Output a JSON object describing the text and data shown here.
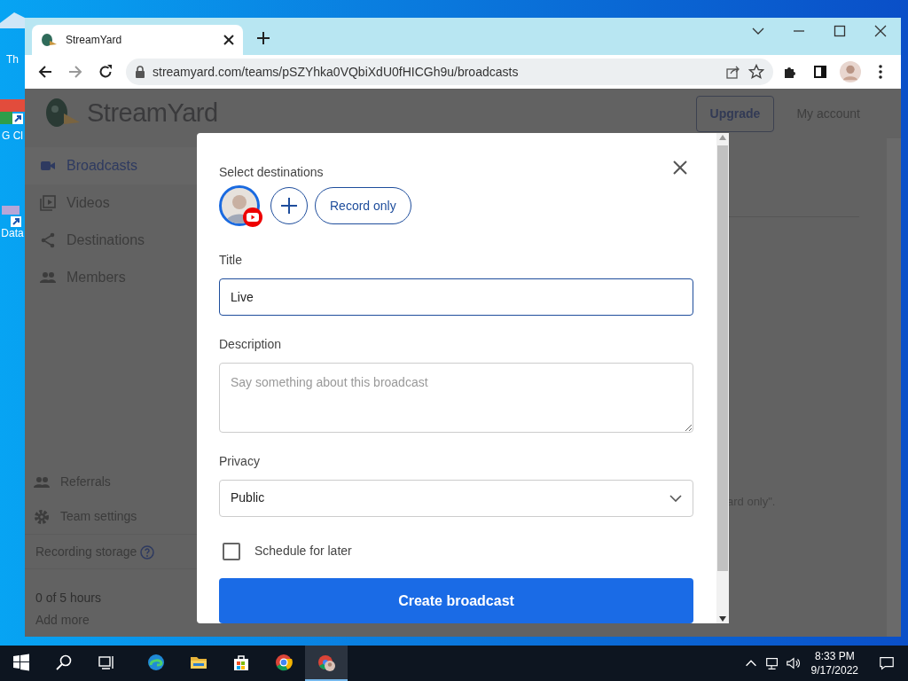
{
  "desktop": {
    "icons": [
      {
        "label": "Th"
      },
      {
        "label": "G Cl"
      },
      {
        "label": "Data"
      }
    ]
  },
  "browser": {
    "tabs": [
      {
        "title": "StreamYard",
        "selected": true
      }
    ],
    "url": "streamyard.com/teams/pSZYhka0VQbiXdU0fHICGh9u/broadcasts"
  },
  "page": {
    "logo": "StreamYard",
    "upgrade": "Upgrade",
    "account": "My account",
    "sidebar": [
      {
        "label": "Broadcasts",
        "selected": true
      },
      {
        "label": "Videos",
        "selected": false
      },
      {
        "label": "Destinations",
        "selected": false
      },
      {
        "label": "Members",
        "selected": false
      }
    ],
    "bottom_items": [
      {
        "label": "Referrals"
      },
      {
        "label": "Team settings"
      }
    ],
    "storage": {
      "label": "Recording storage",
      "usage": "0 of 5 hours",
      "link": "Add more"
    },
    "background_text": "ard only\"."
  },
  "modal": {
    "destinations_label": "Select destinations",
    "destinations": [
      {
        "kind": "avatar",
        "selected": true
      },
      {
        "kind": "add"
      },
      {
        "kind": "pill",
        "label": "Record only"
      }
    ],
    "fields": [
      {
        "kind": "text",
        "label": "Title",
        "value": "Live",
        "focused": true
      },
      {
        "kind": "textarea",
        "label": "Description",
        "placeholder": "Say something about this broadcast",
        "focused": false
      },
      {
        "kind": "select",
        "label": "Privacy",
        "value": "Public",
        "focused": false
      }
    ],
    "schedule": {
      "label": "Schedule for later",
      "checked": false
    },
    "submit": "Create broadcast"
  },
  "taskbar": {
    "apps": [
      {
        "kind": "edge",
        "selected": false
      },
      {
        "kind": "folder",
        "selected": false
      },
      {
        "kind": "store",
        "selected": false
      },
      {
        "kind": "chrome",
        "selected": false
      },
      {
        "kind": "chrome-profile",
        "selected": true
      }
    ],
    "time": "8:33 PM",
    "date": "9/17/2022"
  }
}
